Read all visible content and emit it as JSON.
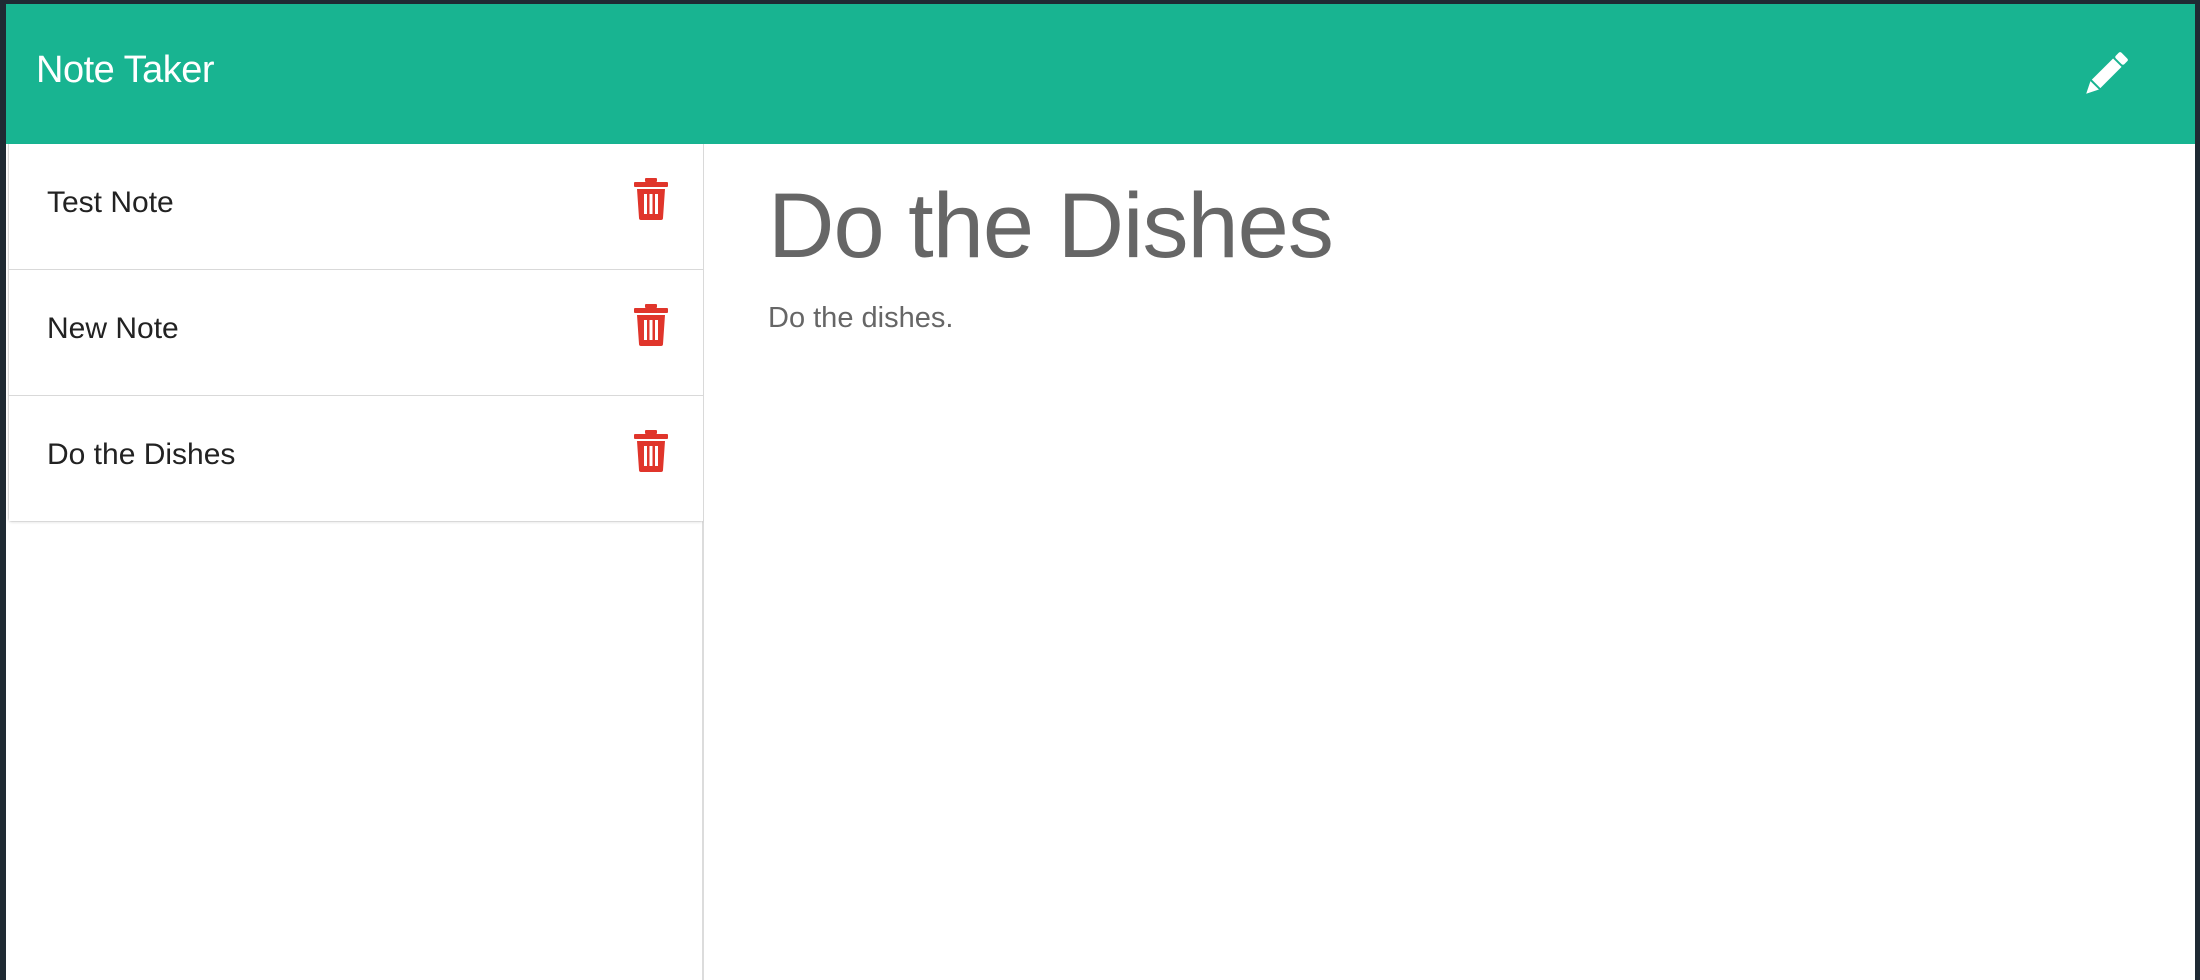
{
  "app": {
    "title": "Note Taker",
    "accent_color": "#18b491",
    "delete_color": "#e0352b"
  },
  "header": {
    "new_note_icon": "pencil-icon"
  },
  "sidebar": {
    "notes": [
      {
        "title": "Test Note",
        "delete_icon": "trash-icon"
      },
      {
        "title": "New Note",
        "delete_icon": "trash-icon"
      },
      {
        "title": "Do the Dishes",
        "delete_icon": "trash-icon"
      }
    ]
  },
  "editor": {
    "title": "Do the Dishes",
    "body": "Do the dishes."
  }
}
